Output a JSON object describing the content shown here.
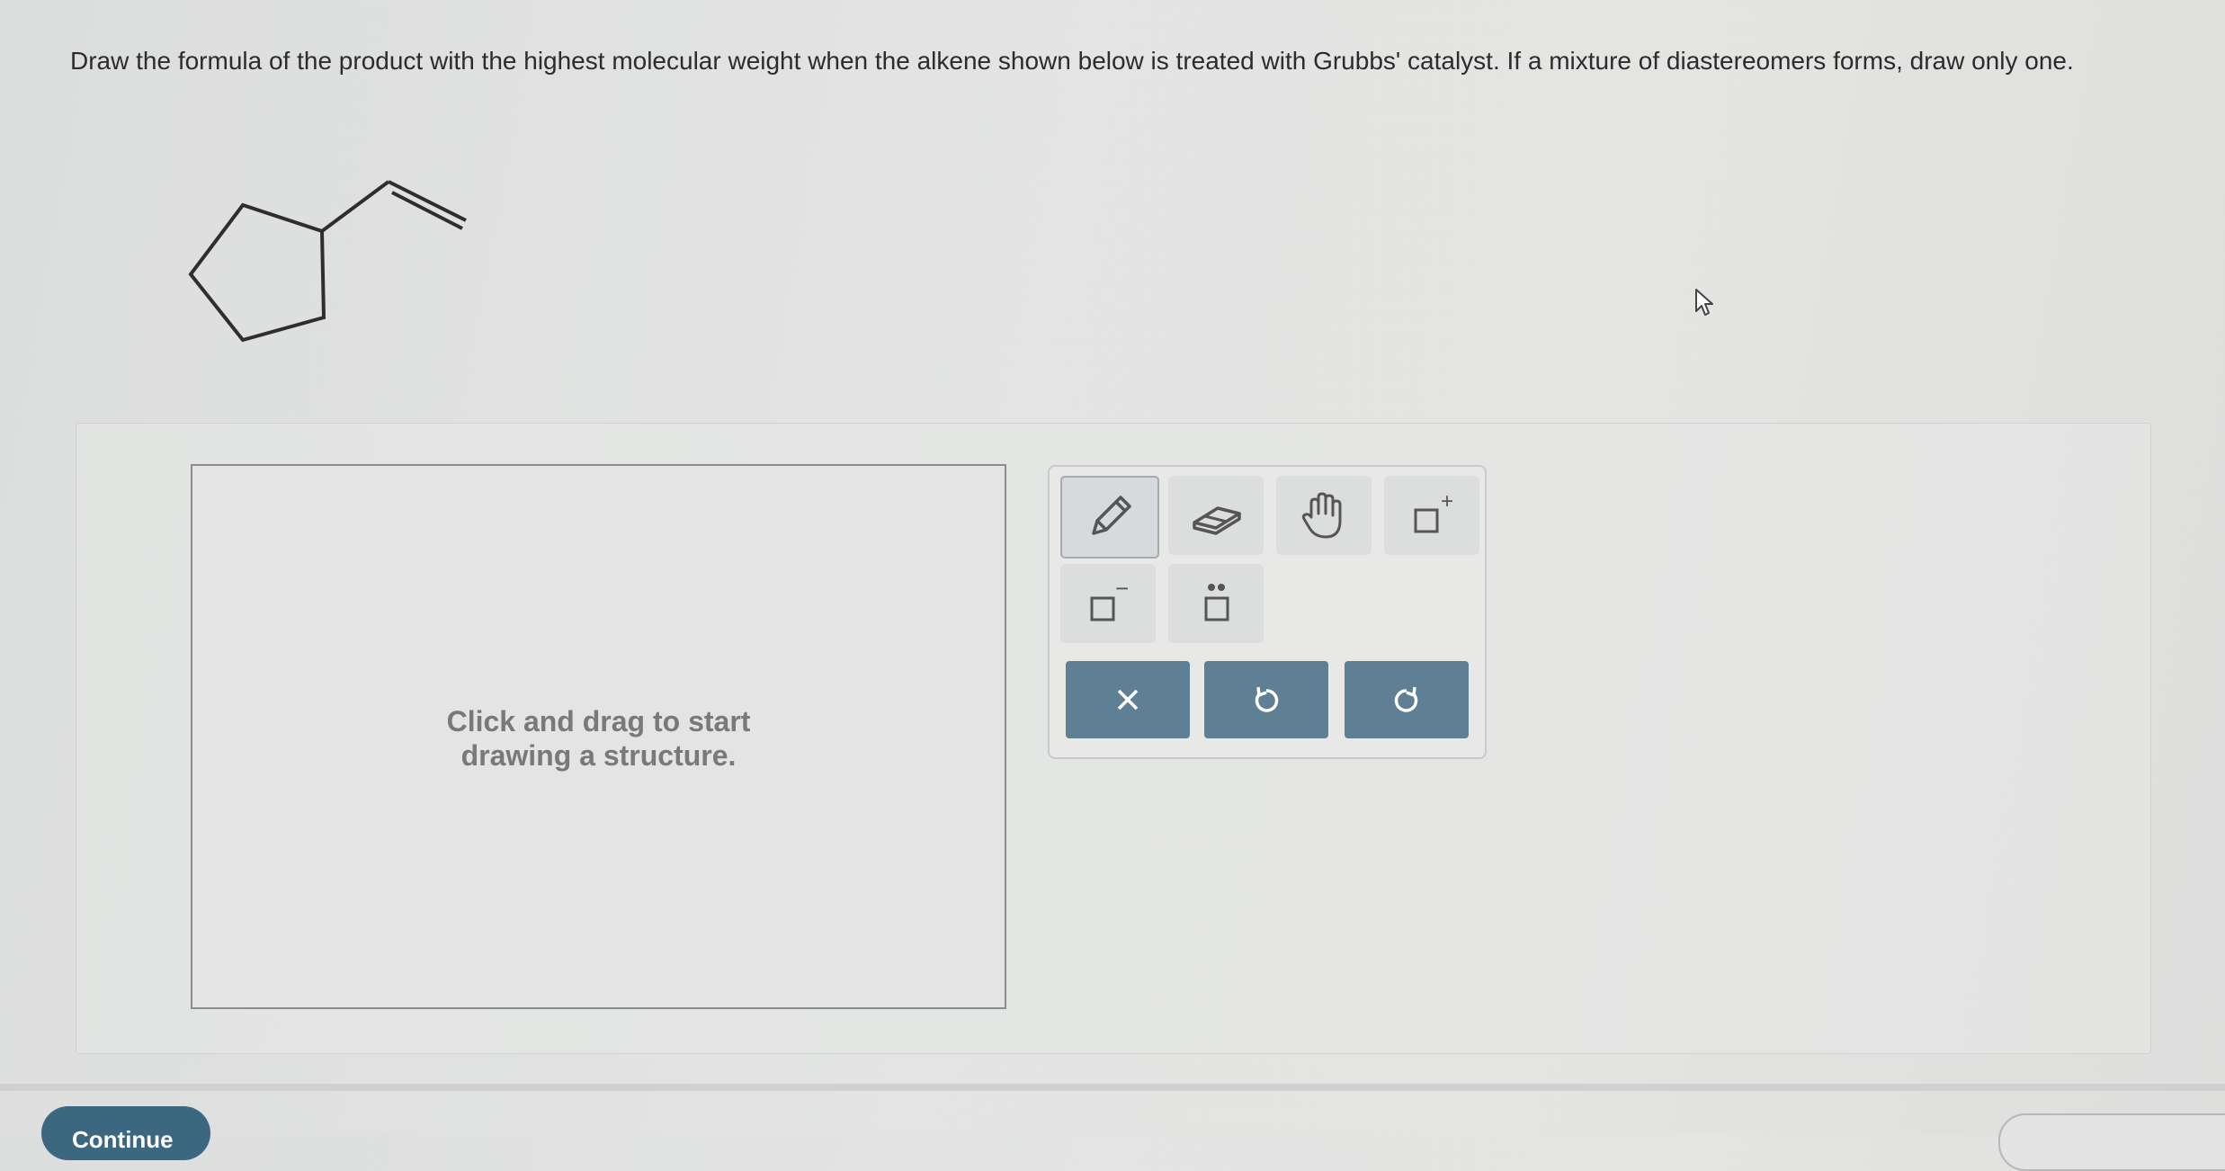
{
  "question": {
    "text": "Draw the formula of the product with the highest molecular weight when the alkene shown below is treated with Grubbs' catalyst. If a mixture of diastereomers forms, draw only one."
  },
  "molecule": {
    "name": "vinylcyclopentane"
  },
  "canvas": {
    "hint": "Click and drag to start\ndrawing a structure."
  },
  "toolbar": {
    "tools": [
      {
        "name": "pencil-icon",
        "selected": true
      },
      {
        "name": "eraser-icon",
        "selected": false
      },
      {
        "name": "hand-icon",
        "selected": false
      },
      {
        "name": "positive-charge-icon",
        "selected": false
      },
      {
        "name": "negative-charge-icon",
        "selected": false
      },
      {
        "name": "lone-pair-icon",
        "selected": false
      }
    ],
    "actions": [
      {
        "name": "clear-icon"
      },
      {
        "name": "undo-icon"
      },
      {
        "name": "redo-icon"
      }
    ],
    "charge_plus": "+",
    "charge_minus": "−"
  },
  "footer": {
    "continue_label": "Continue"
  },
  "colors": {
    "accent": "#5f7f94",
    "continue": "#3c6780",
    "background": "#e2e3e2"
  }
}
